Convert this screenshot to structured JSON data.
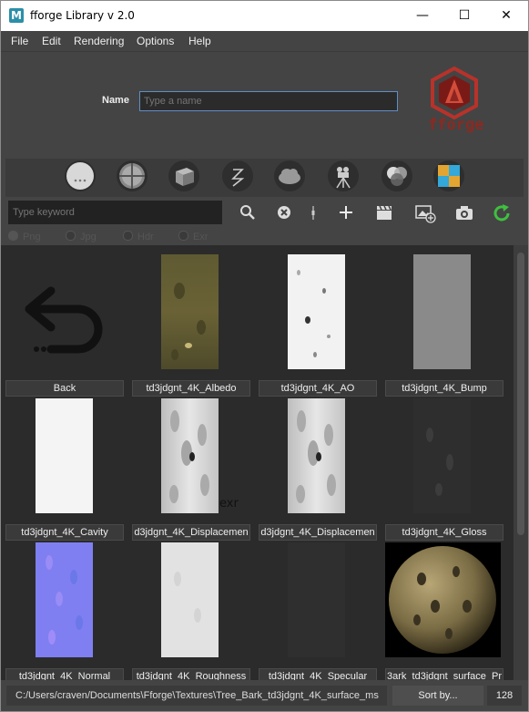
{
  "window": {
    "title": "fforge Library v 2.0",
    "app_icon_letter": "M",
    "minimize": "—",
    "maximize": "☐",
    "close": "✕"
  },
  "menu": [
    "File",
    "Edit",
    "Rendering",
    "Options",
    "Help"
  ],
  "header": {
    "name_label": "Name",
    "name_placeholder": "Type a name",
    "logo_text": "fforge"
  },
  "toolbar": {
    "icons": [
      "default-sphere-icon",
      "shader-ball-icon",
      "cube-icon",
      "zbrush-icon",
      "cloud-icon",
      "camera-rig-icon",
      "color-mix-icon",
      "substance-icon"
    ]
  },
  "search": {
    "placeholder": "Type keyword"
  },
  "actions": {
    "search": "🔍",
    "clear": "⊗",
    "pipe": "❙",
    "add": "+",
    "clapper": "🎬",
    "image_add": "🖼",
    "snapshot": "📷",
    "refresh": "↻"
  },
  "formats": [
    "Png",
    "Jpg",
    "Hdr",
    "Exr"
  ],
  "items": [
    {
      "label": "Back",
      "kind": "back"
    },
    {
      "label": "td3jdgnt_4K_Albedo",
      "kind": "albedo"
    },
    {
      "label": "td3jdgnt_4K_AO",
      "kind": "ao"
    },
    {
      "label": "td3jdgnt_4K_Bump",
      "kind": "bump"
    },
    {
      "label": "td3jdgnt_4K_Cavity",
      "kind": "cavity"
    },
    {
      "label": "d3jdgnt_4K_Displacemen",
      "kind": "disp",
      "badge": "exr"
    },
    {
      "label": "d3jdgnt_4K_Displacemen",
      "kind": "disp"
    },
    {
      "label": "td3jdgnt_4K_Gloss",
      "kind": "gloss"
    },
    {
      "label": "td3jdgnt_4K_Normal",
      "kind": "normal"
    },
    {
      "label": "td3jdgnt_4K_Roughness",
      "kind": "rough"
    },
    {
      "label": "td3jdgnt_4K_Specular",
      "kind": "spec"
    },
    {
      "label": "3ark_td3jdgnt_surface_Pr",
      "kind": "sphere"
    }
  ],
  "status": {
    "path": "C:/Users/craven/Documents\\Fforge\\Textures\\Tree_Bark_td3jdgnt_4K_surface_ms",
    "sort_label": "Sort by...",
    "count": "128"
  }
}
